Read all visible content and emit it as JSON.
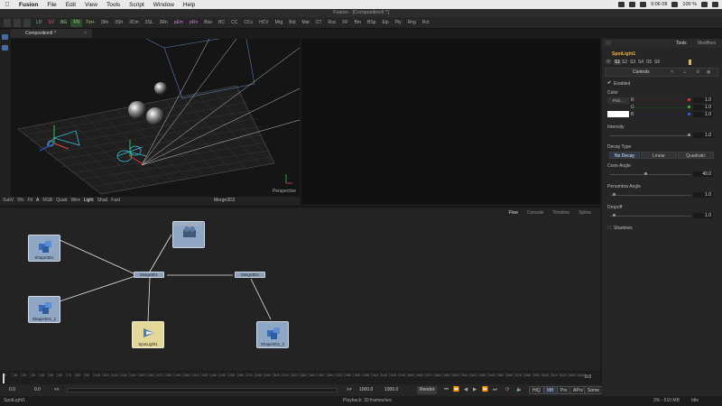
{
  "menubar": {
    "apple": "",
    "items": [
      "Fusion",
      "File",
      "Edit",
      "View",
      "Tools",
      "Script",
      "Window",
      "Help"
    ],
    "clock": "9:06 08",
    "battery": "100 %"
  },
  "window": {
    "title": "Fusion - [Composition6 *]"
  },
  "toolbar": {
    "buttons": [
      "LD",
      "SV",
      "BG",
      "FN",
      "Txt+",
      "3Im",
      "3Sh",
      "3Cm",
      "3SL",
      "3Rn",
      "pEm",
      "pRn",
      "Blur",
      "BC",
      "CC",
      "CCv",
      "HCV",
      "Mrg",
      "Bol",
      "Mat",
      "CT",
      "Rsz",
      "XF",
      "Bm",
      "BSp",
      "Elp",
      "Ply",
      "Rng",
      "Rct"
    ]
  },
  "viewer": {
    "tab_label": "Composition6 *",
    "close": "×",
    "perspective_label": "Perspective",
    "bar": [
      "SubV",
      "9%",
      "Fit",
      "A",
      "RGB",
      "Quad",
      "Wire",
      "Light",
      "Shad",
      "Fast"
    ],
    "node_label": "Merge3D2"
  },
  "flow": {
    "tabs": [
      "Flow",
      "Console",
      "Timeline",
      "Spline"
    ],
    "nodes": [
      {
        "name": "Shape3D1",
        "label": "Shape3D1"
      },
      {
        "name": "Shape3D1_1",
        "label": "Shape3D1_1"
      },
      {
        "name": "Camera3D1",
        "label": "Camera3D1"
      },
      {
        "name": "Merge3D1",
        "label": "Merge3D1"
      },
      {
        "name": "Merge3D2",
        "label": "Merge3D2"
      },
      {
        "name": "SpotLight1",
        "label": "SpotLight1"
      },
      {
        "name": "Shape3D1_2",
        "label": "Shape3D1_2"
      }
    ]
  },
  "timeline": {
    "ticks": [
      "0",
      "10",
      "20",
      "30",
      "40",
      "50",
      "60",
      "70",
      "80",
      "90",
      "100",
      "110",
      "120",
      "130",
      "140",
      "150",
      "160",
      "170",
      "180",
      "190",
      "200",
      "210",
      "220",
      "230",
      "240",
      "250",
      "260",
      "270",
      "280",
      "290",
      "300",
      "310",
      "320",
      "330",
      "340",
      "350",
      "360",
      "370",
      "380",
      "390",
      "400",
      "410",
      "420",
      "430",
      "440",
      "450",
      "460",
      "470",
      "480",
      "490",
      "500",
      "510",
      "520",
      "530",
      "540",
      "550",
      "560",
      "570",
      "580",
      "590",
      "600",
      "610",
      "620",
      "630",
      "640"
    ],
    "current": "0.0",
    "start": "0.0",
    "render_start": "0.0",
    "render_end": "1000.0",
    "end_a": "1000.0",
    "end_b": "1000.0",
    "scroll_left": "<<",
    "scroll_right": ">>",
    "render_label": "Render",
    "end_marker": "0.0",
    "toggles": [
      "HiQ",
      "MB",
      "Prx",
      "APrx",
      "Some"
    ]
  },
  "statusbar": {
    "left": "SpotLight1",
    "center": "Playback: 30 frames/sec",
    "right": "3% - 510 MB",
    "state": "Idle"
  },
  "inspector": {
    "tabs": [
      "Tools",
      "Modifiers"
    ],
    "tool_name": "SpotLight1",
    "version_tabs": [
      "S1",
      "S2",
      "S3",
      "S4",
      "S5",
      "S6"
    ],
    "controls_title": "Controls",
    "enabled_label": "Enabled",
    "color_label": "Color",
    "color_channels": [
      {
        "name": "R",
        "value": "1.0"
      },
      {
        "name": "G",
        "value": "1.0"
      },
      {
        "name": "B",
        "value": "1.0"
      }
    ],
    "pick_label": "Pick...",
    "intensity_label": "Intensity",
    "intensity_value": "1.0",
    "decay_label": "Decay Type",
    "decay_options": [
      "No Decay",
      "Linear",
      "Quadratic"
    ],
    "decay_selected": "No Decay",
    "cone_label": "Cone Angle",
    "cone_value": "40.0",
    "penumbra_label": "Penumbra Angle",
    "penumbra_value": "1.0",
    "dropoff_label": "Dropoff",
    "dropoff_value": "1.0",
    "shadows_label": "Shadows"
  },
  "colors": {
    "accent_blue": "#8fa6c4",
    "accent_yellow": "#e8b73e",
    "light_node": "#e4d79a"
  }
}
